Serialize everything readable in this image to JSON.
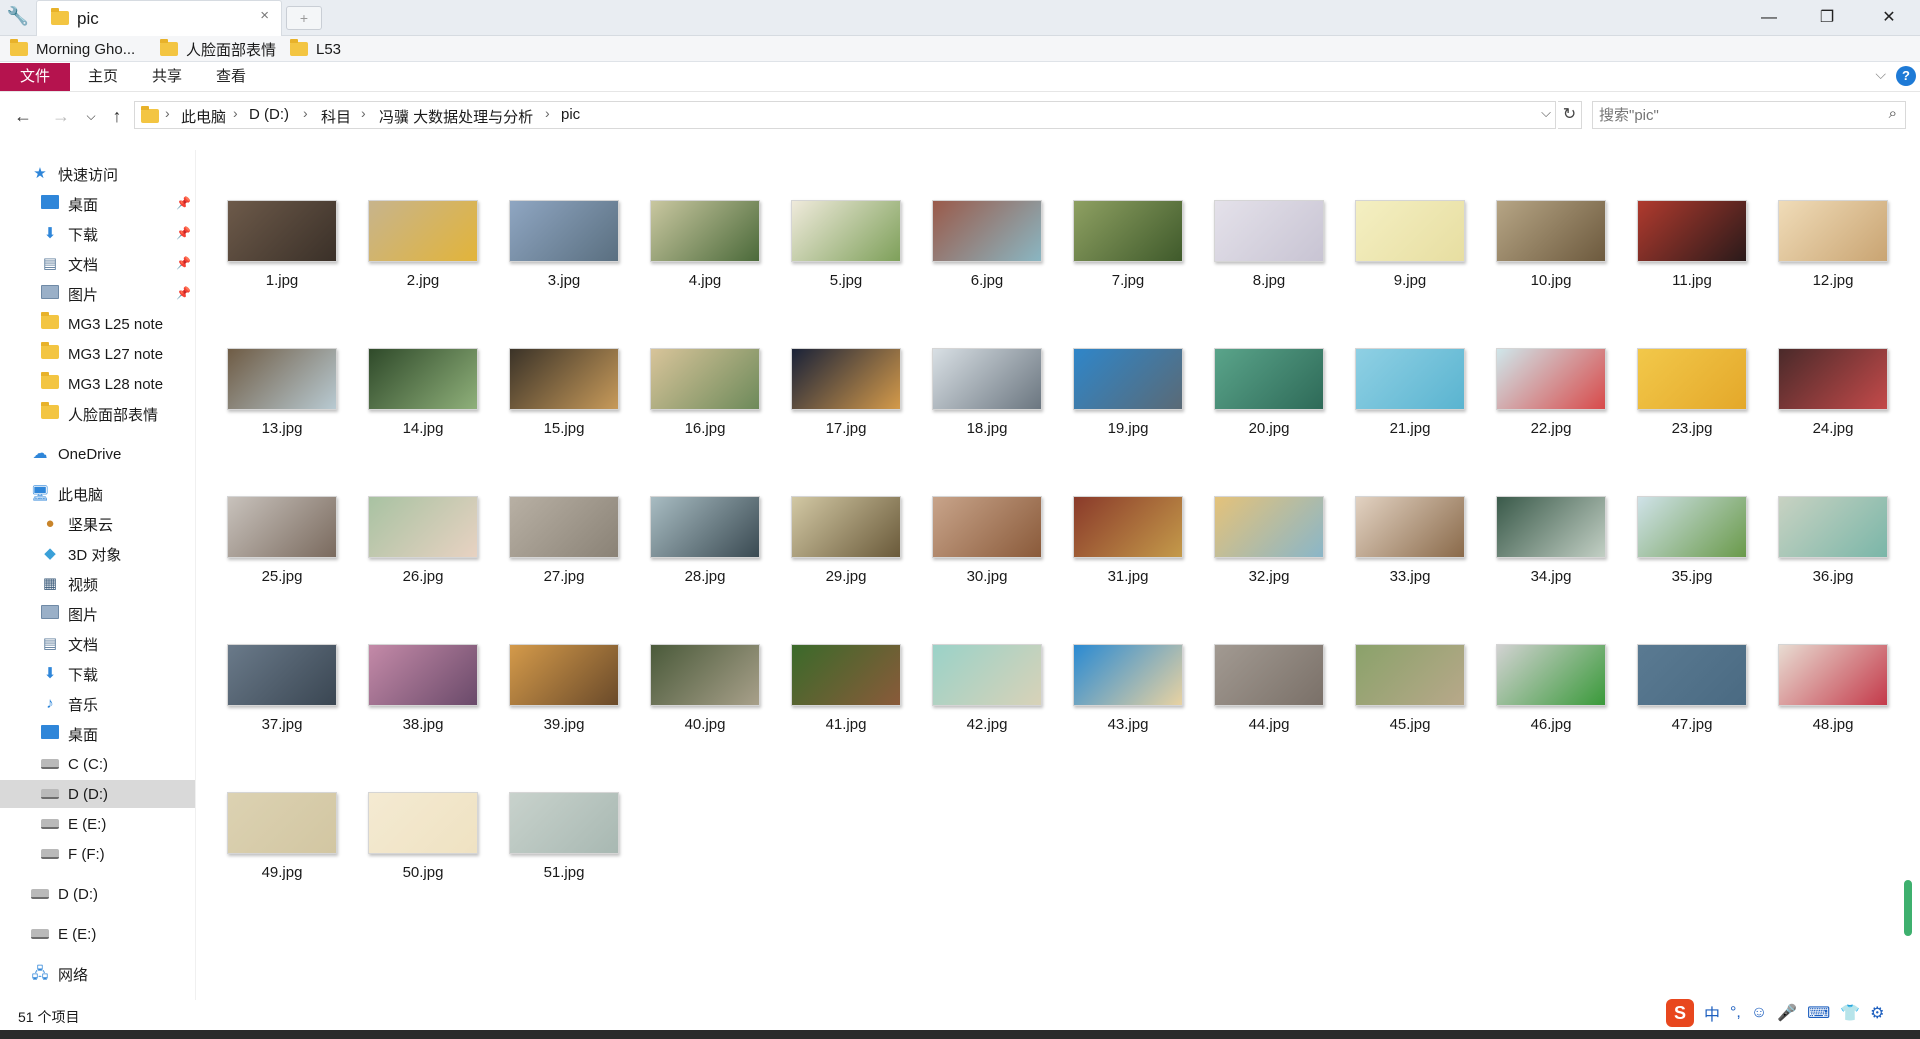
{
  "window": {
    "tab_title": "pic",
    "tab_close": "×",
    "new_tab": "+",
    "minimize": "—",
    "restore": "❐",
    "close": "✕"
  },
  "bookmarks": [
    {
      "label": "Morning Gho..."
    },
    {
      "label": "人脸面部表情"
    },
    {
      "label": "L53"
    }
  ],
  "ribbon": {
    "file": "文件",
    "tabs": [
      "主页",
      "共享",
      "查看"
    ]
  },
  "address": {
    "crumbs": [
      "此电脑",
      "D (D:)",
      "科目",
      "冯骥 大数据处理与分析",
      "pic"
    ],
    "search_placeholder": "搜索\"pic\""
  },
  "sidebar": {
    "quick_access": "快速访问",
    "quick_items": [
      {
        "label": "桌面",
        "icon": "desktop-icon",
        "pinned": true
      },
      {
        "label": "下载",
        "icon": "download-icon",
        "pinned": true
      },
      {
        "label": "文档",
        "icon": "document-icon",
        "pinned": true
      },
      {
        "label": "图片",
        "icon": "pictures-icon",
        "pinned": true
      },
      {
        "label": "MG3 L25 note",
        "icon": "folder-icon",
        "pinned": false
      },
      {
        "label": "MG3 L27 note",
        "icon": "folder-icon",
        "pinned": false
      },
      {
        "label": "MG3 L28 note",
        "icon": "folder-icon",
        "pinned": false
      },
      {
        "label": "人脸面部表情",
        "icon": "folder-icon",
        "pinned": false
      }
    ],
    "onedrive": "OneDrive",
    "this_pc": "此电脑",
    "pc_items": [
      {
        "label": "坚果云",
        "icon": "nutstore-icon"
      },
      {
        "label": "3D 对象",
        "icon": "3d-objects-icon"
      },
      {
        "label": "视频",
        "icon": "video-icon"
      },
      {
        "label": "图片",
        "icon": "pictures-icon"
      },
      {
        "label": "文档",
        "icon": "document-icon"
      },
      {
        "label": "下载",
        "icon": "download-icon"
      },
      {
        "label": "音乐",
        "icon": "music-icon"
      },
      {
        "label": "桌面",
        "icon": "desktop-icon"
      },
      {
        "label": "C (C:)",
        "icon": "drive-icon"
      },
      {
        "label": "D (D:)",
        "icon": "drive-icon",
        "selected": true
      },
      {
        "label": "E (E:)",
        "icon": "drive-icon"
      },
      {
        "label": "F (F:)",
        "icon": "drive-icon"
      }
    ],
    "extra_drives": [
      {
        "label": "D (D:)"
      },
      {
        "label": "E (E:)"
      }
    ],
    "network": "网络"
  },
  "files": [
    {
      "name": "1.jpg",
      "c1": "#6d5a4a",
      "c2": "#3a3028"
    },
    {
      "name": "2.jpg",
      "c1": "#c7b48c",
      "c2": "#e2b43a"
    },
    {
      "name": "3.jpg",
      "c1": "#8fa6c2",
      "c2": "#5a6f80"
    },
    {
      "name": "4.jpg",
      "c1": "#c9c7a0",
      "c2": "#4b6a3a"
    },
    {
      "name": "5.jpg",
      "c1": "#efeadb",
      "c2": "#7ea05a"
    },
    {
      "name": "6.jpg",
      "c1": "#9a5a4a",
      "c2": "#8ab6c2"
    },
    {
      "name": "7.jpg",
      "c1": "#8ea062",
      "c2": "#3f5a2b"
    },
    {
      "name": "8.jpg",
      "c1": "#e4e1ea",
      "c2": "#c8c4d3"
    },
    {
      "name": "9.jpg",
      "c1": "#f4efc2",
      "c2": "#e7dea1"
    },
    {
      "name": "10.jpg",
      "c1": "#b6a585",
      "c2": "#6d5a3e"
    },
    {
      "name": "11.jpg",
      "c1": "#b03a2e",
      "c2": "#2a1a1a"
    },
    {
      "name": "12.jpg",
      "c1": "#f0dcb8",
      "c2": "#c9a472"
    },
    {
      "name": "13.jpg",
      "c1": "#6f5c45",
      "c2": "#b8cad2"
    },
    {
      "name": "14.jpg",
      "c1": "#2f4a2a",
      "c2": "#8fb07a"
    },
    {
      "name": "15.jpg",
      "c1": "#3b3328",
      "c2": "#c79a5a"
    },
    {
      "name": "16.jpg",
      "c1": "#d8c49a",
      "c2": "#6d8a5a"
    },
    {
      "name": "17.jpg",
      "c1": "#1a2238",
      "c2": "#d49a4a"
    },
    {
      "name": "18.jpg",
      "c1": "#d8dfe4",
      "c2": "#6b7680"
    },
    {
      "name": "19.jpg",
      "c1": "#2f86c9",
      "c2": "#5a6a76"
    },
    {
      "name": "20.jpg",
      "c1": "#5aa48a",
      "c2": "#2e6a58"
    },
    {
      "name": "21.jpg",
      "c1": "#8fd0e4",
      "c2": "#5ab4d0"
    },
    {
      "name": "22.jpg",
      "c1": "#cfe6ea",
      "c2": "#d84a4a"
    },
    {
      "name": "23.jpg",
      "c1": "#f2c84a",
      "c2": "#e4a82a"
    },
    {
      "name": "24.jpg",
      "c1": "#4a2a2a",
      "c2": "#c44a4a"
    },
    {
      "name": "25.jpg",
      "c1": "#c8c2bc",
      "c2": "#7a6a5e"
    },
    {
      "name": "26.jpg",
      "c1": "#a8c2a2",
      "c2": "#e8d2c2"
    },
    {
      "name": "27.jpg",
      "c1": "#b8b0a4",
      "c2": "#8a8276"
    },
    {
      "name": "28.jpg",
      "c1": "#a8bcc2",
      "c2": "#3a4a52"
    },
    {
      "name": "29.jpg",
      "c1": "#d2c8a4",
      "c2": "#6a5a3a"
    },
    {
      "name": "30.jpg",
      "c1": "#c8a48a",
      "c2": "#8a5a3a"
    },
    {
      "name": "31.jpg",
      "c1": "#8a3a2a",
      "c2": "#c49a4a"
    },
    {
      "name": "32.jpg",
      "c1": "#e4c27a",
      "c2": "#8ab6c8"
    },
    {
      "name": "33.jpg",
      "c1": "#e2d2c2",
      "c2": "#8a6a4a"
    },
    {
      "name": "34.jpg",
      "c1": "#3a5a4a",
      "c2": "#c2cfc4"
    },
    {
      "name": "35.jpg",
      "c1": "#cfe2e8",
      "c2": "#6a9a4a"
    },
    {
      "name": "36.jpg",
      "c1": "#c8d2c2",
      "c2": "#7ab6a8"
    },
    {
      "name": "37.jpg",
      "c1": "#6a7a8a",
      "c2": "#3a4652"
    },
    {
      "name": "38.jpg",
      "c1": "#c48aa8",
      "c2": "#6a4a6a"
    },
    {
      "name": "39.jpg",
      "c1": "#d49a4a",
      "c2": "#6a4a2a"
    },
    {
      "name": "40.jpg",
      "c1": "#4a5a3a",
      "c2": "#a8a08a"
    },
    {
      "name": "41.jpg",
      "c1": "#3a6a2a",
      "c2": "#8a5a3a"
    },
    {
      "name": "42.jpg",
      "c1": "#9ad2c8",
      "c2": "#d8d2b8"
    },
    {
      "name": "43.jpg",
      "c1": "#2a8ad2",
      "c2": "#e8d2a2"
    },
    {
      "name": "44.jpg",
      "c1": "#a29a92",
      "c2": "#7a7068"
    },
    {
      "name": "45.jpg",
      "c1": "#8aa26a",
      "c2": "#b8a88a"
    },
    {
      "name": "46.jpg",
      "c1": "#d2d2d2",
      "c2": "#3a9a3a"
    },
    {
      "name": "47.jpg",
      "c1": "#5a7a92",
      "c2": "#4a6a82"
    },
    {
      "name": "48.jpg",
      "c1": "#e8dcd2",
      "c2": "#c43a4a"
    },
    {
      "name": "49.jpg",
      "c1": "#dcd2b2",
      "c2": "#d2c6a2"
    },
    {
      "name": "50.jpg",
      "c1": "#f4ead2",
      "c2": "#efe2c2"
    },
    {
      "name": "51.jpg",
      "c1": "#c8d2cc",
      "c2": "#a8b8b2"
    }
  ],
  "status": {
    "count": "51 个项目"
  },
  "ime": {
    "logo": "S",
    "mode": "中",
    "punct": "°,",
    "items": [
      "☺",
      "🎤",
      "⌨",
      "👕",
      "⚙"
    ]
  }
}
